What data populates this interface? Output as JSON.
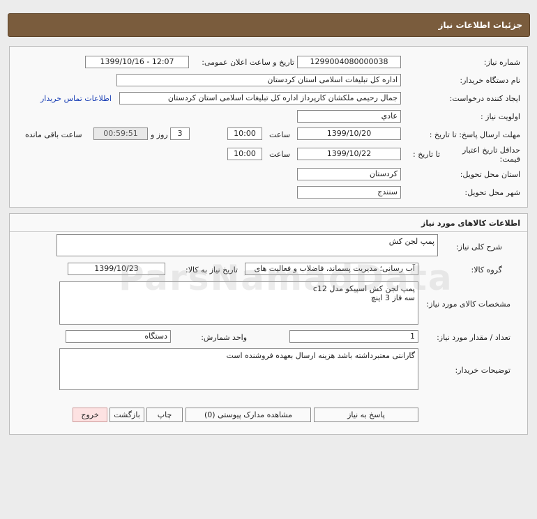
{
  "header": {
    "title": "جزئیات اطلاعات نیاز"
  },
  "info": {
    "need_number_label": "شماره نیاز:",
    "need_number": "1299004080000038",
    "announce_label": "تاریخ و ساعت اعلان عمومی:",
    "announce_value": "1399/10/16 - 12:07",
    "buyer_org_label": "نام دستگاه خریدار:",
    "buyer_org": "اداره کل تبلیغات اسلامی استان کردستان",
    "requester_label": "ایجاد کننده درخواست:",
    "requester": "جمال رحیمی ملکشان کارپرداز اداره کل تبلیغات اسلامی استان کردستان",
    "contact_link": "اطلاعات تماس خریدار",
    "priority_label": "اولویت نیاز :",
    "priority": "عادي",
    "send_deadline_label": "مهلت ارسال پاسخ: تا تاریخ :",
    "send_deadline_date": "1399/10/20",
    "time_label": "ساعت",
    "send_deadline_time": "10:00",
    "days_value": "3",
    "days_label": "روز و",
    "remaining_time": "00:59:51",
    "remaining_label": "ساعت باقی مانده",
    "validity_label": "حداقل تاریخ اعتبار قیمت:",
    "validity_to_label": "تا تاریخ :",
    "validity_date": "1399/10/22",
    "validity_time_label": "ساعت",
    "validity_time": "10:00",
    "province_label": "استان محل تحویل:",
    "province": "کردستان",
    "city_label": "شهر محل تحویل:",
    "city": "سنندج"
  },
  "goods": {
    "title": "اطلاعات کالاهای مورد نیاز",
    "desc_label": "شرح کلی نیاز:",
    "desc": "پمپ لجن کش",
    "group_label": "گروه کالا:",
    "group": "آب رسانی؛ مدیریت پسماند، فاضلاب و فعالیت های",
    "need_date_label": "تاریخ نیاز به کالا:",
    "need_date": "1399/10/23",
    "specs_label": "مشخصات کالای مورد نیاز:",
    "specs": "پمپ لجن کش اسپیکو مدل c12\nسه فاز 3 اینچ",
    "qty_label": "تعداد / مقدار مورد نیاز:",
    "qty": "1",
    "unit_label": "واحد شمارش:",
    "unit": "دستگاه",
    "buyer_notes_label": "توضیحات خریدار:",
    "buyer_notes": "گارانتی معتبرداشته باشد هزینه ارسال بعهده فروشنده است"
  },
  "buttons": {
    "reply": "پاسخ به نیاز",
    "attachments": "مشاهده مدارک پیوستی (0)",
    "print": "چاپ",
    "back": "بازگشت",
    "exit": "خروج"
  }
}
